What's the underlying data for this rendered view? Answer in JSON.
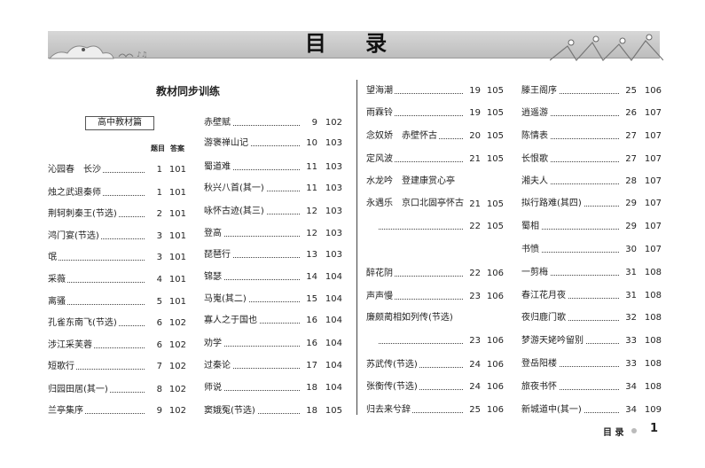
{
  "header": {
    "title": "目 录"
  },
  "section": {
    "heading": "教材同步训练",
    "subheading": "高中教材篇",
    "col_q": "题目",
    "col_a": "答案"
  },
  "column1": [
    {
      "title": "沁园春　长沙",
      "q": "1",
      "a": "101"
    },
    {
      "title": "烛之武退秦师",
      "q": "1",
      "a": "101"
    },
    {
      "title": "荆轲刺秦王(节选)",
      "q": "2",
      "a": "101"
    },
    {
      "title": "鸿门宴(节选)",
      "q": "3",
      "a": "101"
    },
    {
      "title": "氓",
      "q": "3",
      "a": "101"
    },
    {
      "title": "采薇",
      "q": "4",
      "a": "101"
    },
    {
      "title": "离骚",
      "q": "5",
      "a": "101"
    },
    {
      "title": "孔雀东南飞(节选)",
      "q": "6",
      "a": "102"
    },
    {
      "title": "涉江采芙蓉",
      "q": "6",
      "a": "102"
    },
    {
      "title": "短歌行",
      "q": "7",
      "a": "102"
    },
    {
      "title": "归园田居(其一)",
      "q": "8",
      "a": "102"
    },
    {
      "title": "兰亭集序",
      "q": "9",
      "a": "102"
    }
  ],
  "column2": [
    {
      "title": "赤壁赋",
      "q": "9",
      "a": "102"
    },
    {
      "title": "游褒禅山记",
      "q": "10",
      "a": "103"
    },
    {
      "title": "蜀道难",
      "q": "11",
      "a": "103"
    },
    {
      "title": "秋兴八首(其一)",
      "q": "11",
      "a": "103"
    },
    {
      "title": "咏怀古迹(其三)",
      "q": "12",
      "a": "103"
    },
    {
      "title": "登高",
      "q": "12",
      "a": "103"
    },
    {
      "title": "琵琶行",
      "q": "13",
      "a": "103"
    },
    {
      "title": "锦瑟",
      "q": "14",
      "a": "104"
    },
    {
      "title": "马嵬(其二)",
      "q": "15",
      "a": "104"
    },
    {
      "title": "寡人之于国也",
      "q": "16",
      "a": "104"
    },
    {
      "title": "劝学",
      "q": "16",
      "a": "104"
    },
    {
      "title": "过秦论",
      "q": "17",
      "a": "104"
    },
    {
      "title": "师说",
      "q": "18",
      "a": "104"
    },
    {
      "title": "窦娥冤(节选)",
      "q": "18",
      "a": "105"
    }
  ],
  "column3": [
    {
      "title": "望海潮",
      "q": "19",
      "a": "105"
    },
    {
      "title": "雨霖铃",
      "q": "19",
      "a": "105"
    },
    {
      "title": "念奴娇　赤壁怀古",
      "q": "20",
      "a": "105"
    },
    {
      "title": "定风波",
      "q": "21",
      "a": "105"
    },
    {
      "title": "水龙吟　登建康赏心亭",
      "q": "21",
      "a": "105"
    },
    {
      "title": "永遇乐　京口北固亭怀古",
      "q": "22",
      "a": "105"
    },
    {
      "title": "醉花阴",
      "q": "22",
      "a": "106"
    },
    {
      "title": "声声慢",
      "q": "23",
      "a": "106"
    },
    {
      "title": "廉颇蔺相如列传(节选)",
      "q": "23",
      "a": "106"
    },
    {
      "title": "苏武传(节选)",
      "q": "24",
      "a": "106"
    },
    {
      "title": "张衡传(节选)",
      "q": "24",
      "a": "106"
    },
    {
      "title": "归去来兮辞",
      "q": "25",
      "a": "106"
    }
  ],
  "column4": [
    {
      "title": "滕王阁序",
      "q": "25",
      "a": "106"
    },
    {
      "title": "逍遥游",
      "q": "26",
      "a": "107"
    },
    {
      "title": "陈情表",
      "q": "27",
      "a": "107"
    },
    {
      "title": "长恨歌",
      "q": "27",
      "a": "107"
    },
    {
      "title": "湘夫人",
      "q": "28",
      "a": "107"
    },
    {
      "title": "拟行路难(其四)",
      "q": "29",
      "a": "107"
    },
    {
      "title": "蜀相",
      "q": "29",
      "a": "107"
    },
    {
      "title": "书愤",
      "q": "30",
      "a": "107"
    },
    {
      "title": "一剪梅",
      "q": "31",
      "a": "108"
    },
    {
      "title": "春江花月夜",
      "q": "31",
      "a": "108"
    },
    {
      "title": "夜归鹿门歌",
      "q": "32",
      "a": "108"
    },
    {
      "title": "梦游天姥吟留别",
      "q": "33",
      "a": "108"
    },
    {
      "title": "登岳阳楼",
      "q": "33",
      "a": "108"
    },
    {
      "title": "旅夜书怀",
      "q": "34",
      "a": "108"
    },
    {
      "title": "新城道中(其一)",
      "q": "34",
      "a": "109"
    }
  ],
  "footer": {
    "label": "目 录",
    "page": "1"
  }
}
